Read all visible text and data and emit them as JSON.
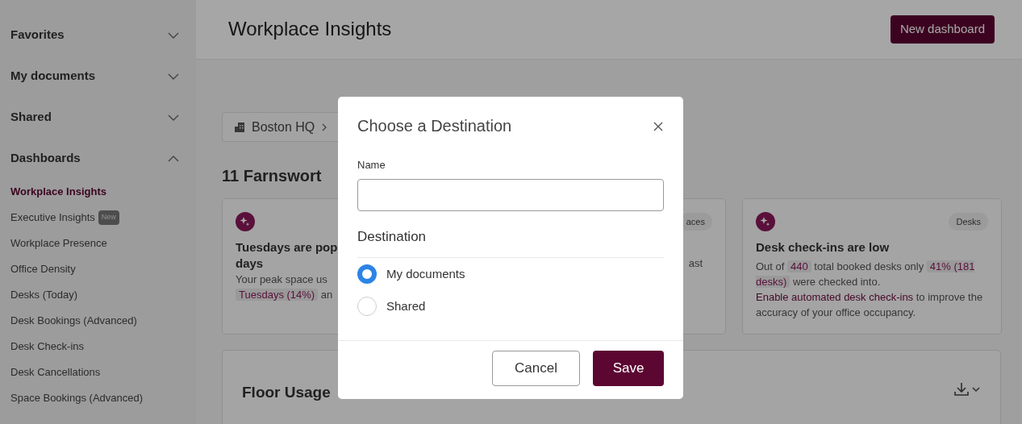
{
  "sidebar": {
    "sections": [
      {
        "label": "Favorites",
        "expanded": false
      },
      {
        "label": "My documents",
        "expanded": false
      },
      {
        "label": "Shared",
        "expanded": false
      },
      {
        "label": "Dashboards",
        "expanded": true,
        "items": [
          {
            "label": "Workplace Insights",
            "selected": true
          },
          {
            "label": "Executive Insights",
            "selected": false,
            "badge": "New"
          },
          {
            "label": "Workplace Presence",
            "selected": false
          },
          {
            "label": "Office Density",
            "selected": false
          },
          {
            "label": "Desks (Today)",
            "selected": false
          },
          {
            "label": "Desk Bookings (Advanced)",
            "selected": false
          },
          {
            "label": "Desk Check-ins",
            "selected": false
          },
          {
            "label": "Desk Cancellations",
            "selected": false
          },
          {
            "label": "Space Bookings (Advanced)",
            "selected": false
          }
        ]
      }
    ]
  },
  "header": {
    "title": "Workplace Insights",
    "button": "New dashboard"
  },
  "breadcrumb": [
    {
      "label": "Boston HQ"
    }
  ],
  "heading": "11 Farnswort",
  "insight_cards": [
    {
      "title_lines": [
        "Tuesdays are pop",
        "days"
      ],
      "body_lines": [
        [
          {
            "kind": "text",
            "text": "Your peak space us"
          }
        ],
        [
          {
            "kind": "highlight",
            "text": "Tuesdays (14%)"
          },
          {
            "kind": "text",
            "text": " an"
          }
        ]
      ]
    },
    {
      "tag": "aces",
      "body_lines": [
        [
          {
            "kind": "text",
            "text": "ast"
          }
        ]
      ]
    },
    {
      "tag": "Desks",
      "title_lines": [
        "Desk check-ins are low"
      ],
      "body": [
        {
          "kind": "text",
          "text": "Out of "
        },
        {
          "kind": "highlight",
          "text": "440"
        },
        {
          "kind": "text",
          "text": " total booked desks only "
        },
        {
          "kind": "highlight",
          "text": "41% (181 desks)"
        },
        {
          "kind": "text",
          "text": " were checked into. "
        },
        {
          "kind": "link",
          "text": "Enable automated desk check-ins"
        },
        {
          "kind": "text",
          "text": " to improve the accuracy of your office occupancy."
        }
      ]
    }
  ],
  "floor_usage": {
    "title": "Floor Usage"
  },
  "dialog": {
    "title": "Choose a Destination",
    "name_label": "Name",
    "destination_label": "Destination",
    "destinations": [
      {
        "label": "My documents",
        "selected": true
      },
      {
        "label": "Shared",
        "selected": false
      }
    ],
    "cancel": "Cancel",
    "save": "Save"
  }
}
